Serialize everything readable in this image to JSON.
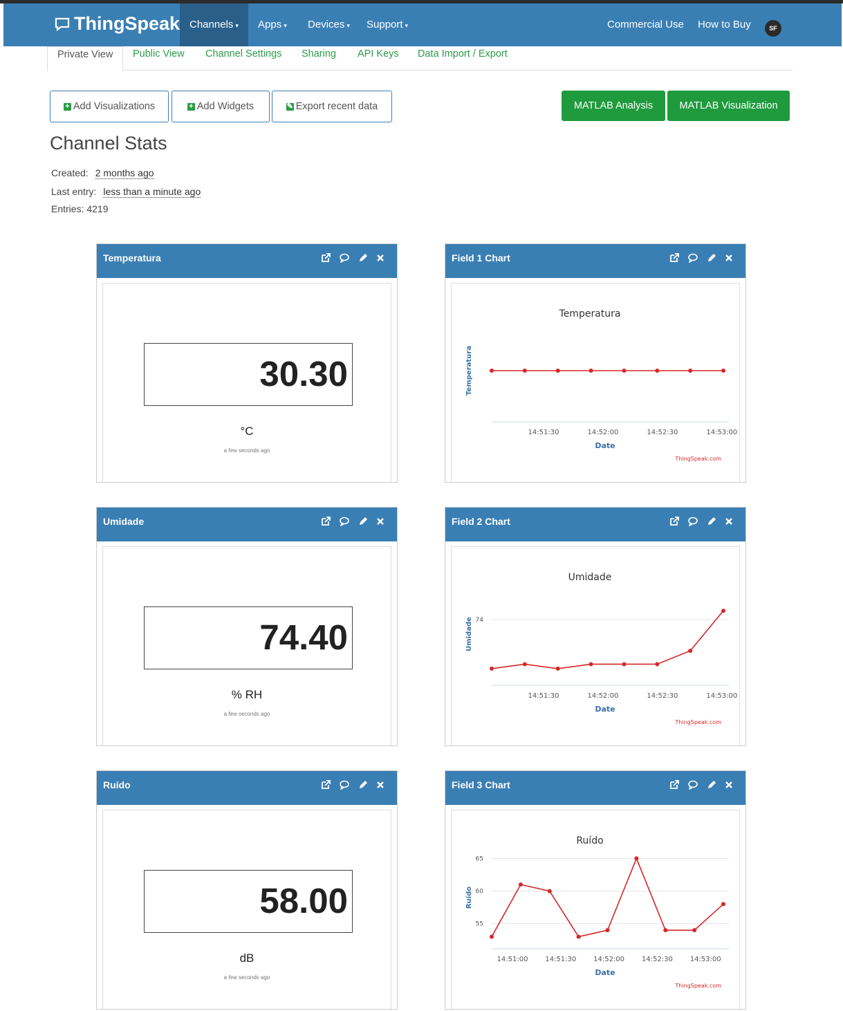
{
  "navbar": {
    "brand": "ThingSpeak",
    "trademark": "™",
    "menu": [
      {
        "label": "Channels",
        "caret": "▾"
      },
      {
        "label": "Apps",
        "caret": "▾"
      },
      {
        "label": "Devices",
        "caret": "▾"
      },
      {
        "label": "Support",
        "caret": "▾"
      }
    ],
    "right": {
      "commercial": "Commercial Use",
      "how_to_buy": "How to Buy",
      "avatar": "SF"
    },
    "color": "#3a7fb4"
  },
  "tabs": [
    "Private View",
    "Public View",
    "Channel Settings",
    "Sharing",
    "API Keys",
    "Data Import / Export"
  ],
  "actions": {
    "add_visualizations": "Add Visualizations",
    "add_widgets": "Add Widgets",
    "export_recent": "Export recent data",
    "matlab_analysis": "MATLAB Analysis",
    "matlab_visualization": "MATLAB Visualization"
  },
  "stats": {
    "title": "Channel Stats",
    "created_label": "Created:",
    "created_value": "2 months ago",
    "last_entry_label": "Last entry:",
    "last_entry_value": "less than a minute ago",
    "entries": "Entries: 4219"
  },
  "widgets": [
    {
      "title": "Temperatura",
      "value": "30.30",
      "unit": "°C",
      "ago": "a few seconds ago"
    },
    {
      "title": "Umidade",
      "value": "74.40",
      "unit": "% RH",
      "ago": "a few seconds ago"
    },
    {
      "title": "Ruído",
      "value": "58.00",
      "unit": "dB",
      "ago": "a few seconds ago"
    }
  ],
  "chart_data": [
    {
      "type": "line",
      "panel_title": "Field 1 Chart",
      "title": "Temperatura",
      "xlabel": "Date",
      "ylabel": "Temperatura",
      "x": [
        "14:50:50",
        "14:51:10",
        "14:51:30",
        "14:51:50",
        "14:52:10",
        "14:52:30",
        "14:52:50",
        "14:53:10"
      ],
      "series": [
        {
          "values": [
            30.3,
            30.3,
            30.3,
            30.3,
            30.3,
            30.3,
            30.3,
            30.3
          ]
        }
      ],
      "x_ticks": [
        "14:51:30",
        "14:52:00",
        "14:52:30",
        "14:53:00"
      ],
      "y_ticks": [],
      "credit": "ThingSpeak.com",
      "color": "#d62728"
    },
    {
      "type": "line",
      "panel_title": "Field 2 Chart",
      "title": "Umidade",
      "xlabel": "Date",
      "ylabel": "Umidade",
      "x": [
        "14:50:50",
        "14:51:10",
        "14:51:30",
        "14:51:50",
        "14:52:10",
        "14:52:30",
        "14:52:50",
        "14:53:10"
      ],
      "series": [
        {
          "values": [
            71.8,
            72.0,
            71.8,
            72.0,
            72.0,
            72.0,
            72.6,
            74.4
          ]
        }
      ],
      "x_ticks": [
        "14:51:30",
        "14:52:00",
        "14:52:30",
        "14:53:00"
      ],
      "y_ticks": [
        "74"
      ],
      "credit": "ThingSpeak.com",
      "color": "#d62728"
    },
    {
      "type": "line",
      "panel_title": "Field 3 Chart",
      "title": "Ruído",
      "xlabel": "Date",
      "ylabel": "Ruído",
      "x": [
        "14:50:50",
        "14:51:10",
        "14:51:30",
        "14:51:50",
        "14:52:10",
        "14:52:30",
        "14:52:50",
        "14:53:10"
      ],
      "series": [
        {
          "values": [
            53,
            61,
            60,
            53,
            54,
            65,
            54,
            54,
            58
          ]
        }
      ],
      "x_ticks": [
        "14:51:00",
        "14:51:30",
        "14:52:00",
        "14:52:30",
        "14:53:00"
      ],
      "y_ticks": [
        "65",
        "60",
        "55"
      ],
      "credit": "ThingSpeak.com",
      "color": "#d62728"
    }
  ]
}
